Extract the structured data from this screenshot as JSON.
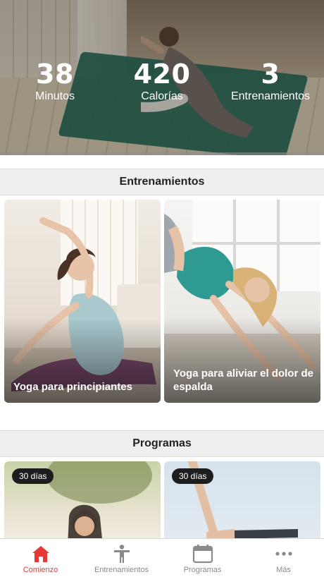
{
  "stats": [
    {
      "value": "38",
      "label": "Minutos"
    },
    {
      "value": "420",
      "label": "Calorías"
    },
    {
      "value": "3",
      "label": "Entrenamientos"
    }
  ],
  "sections": {
    "workouts_title": "Entrenamientos",
    "programs_title": "Programas"
  },
  "workouts": [
    {
      "title": "Yoga para principiantes"
    },
    {
      "title": "Yoga para aliviar el dolor de espalda"
    }
  ],
  "programs": [
    {
      "badge": "30 días"
    },
    {
      "badge": "30 días"
    }
  ],
  "nav": {
    "items": [
      {
        "label": "Comienzo",
        "icon": "home-icon",
        "active": true
      },
      {
        "label": "Entrenamientos",
        "icon": "person-icon",
        "active": false
      },
      {
        "label": "Programas",
        "icon": "calendar-icon",
        "active": false
      },
      {
        "label": "Más",
        "icon": "more-icon",
        "active": false
      }
    ],
    "active_color": "#e53935",
    "inactive_color": "#8a8a8a"
  }
}
